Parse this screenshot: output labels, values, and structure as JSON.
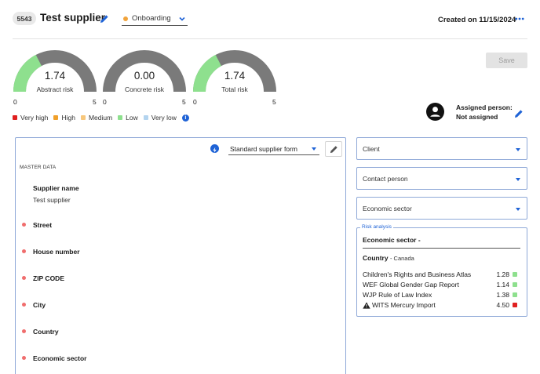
{
  "header": {
    "supplier_id": "5543",
    "supplier_title": "Test supplier",
    "status": "Onboarding",
    "created": "Created on 11/15/2024"
  },
  "gauges": [
    {
      "value": 1.74,
      "value_text": "1.74",
      "label": "Abstract risk",
      "min": "0",
      "max": "5",
      "fill_color": "#8ee08e"
    },
    {
      "value": 0.0,
      "value_text": "0.00",
      "label": "Concrete risk",
      "min": "0",
      "max": "5",
      "fill_color": "#8ee08e"
    },
    {
      "value": 1.74,
      "value_text": "1.74",
      "label": "Total risk",
      "min": "0",
      "max": "5",
      "fill_color": "#8ee08e"
    }
  ],
  "legend": [
    {
      "label": "Very high",
      "color": "#e02020"
    },
    {
      "label": "High",
      "color": "#f0a02a"
    },
    {
      "label": "Medium",
      "color": "#f7c77c"
    },
    {
      "label": "Low",
      "color": "#8ee08e"
    },
    {
      "label": "Very low",
      "color": "#b3d4ef"
    }
  ],
  "actions": {
    "save_label": "Save"
  },
  "assigned": {
    "line1": "Assigned person:",
    "line2": "Not assigned"
  },
  "form": {
    "selector": "Standard supplier form",
    "section_title": "MASTER DATA",
    "supplier_name_label": "Supplier name",
    "supplier_name_value": "Test supplier",
    "fields": [
      "Street",
      "House number",
      "ZIP CODE",
      "City",
      "Country",
      "Economic sector"
    ]
  },
  "dropdowns": [
    "Client",
    "Contact person",
    "Economic sector"
  ],
  "risk_analysis": {
    "legend": "Risk analysis",
    "sector_line": "Economic sector -",
    "country_label": "Country",
    "country_value": "- Canada",
    "indices": [
      {
        "name": "Children's Rights and Business Atlas",
        "value": "1.28",
        "color": "#8ee08e",
        "warning": false
      },
      {
        "name": "WEF Global Gender Gap Report",
        "value": "1.14",
        "color": "#8ee08e",
        "warning": false
      },
      {
        "name": "WJP Rule of Law Index",
        "value": "1.38",
        "color": "#8ee08e",
        "warning": false
      },
      {
        "name": "WITS Mercury Import",
        "value": "4.50",
        "color": "#e02020",
        "warning": true
      }
    ]
  },
  "colors": {
    "accent": "#1f63d6",
    "status_dot": "#f1a33b",
    "required_dot": "#f06d6d",
    "gauge_track": "#7a7a7a"
  }
}
